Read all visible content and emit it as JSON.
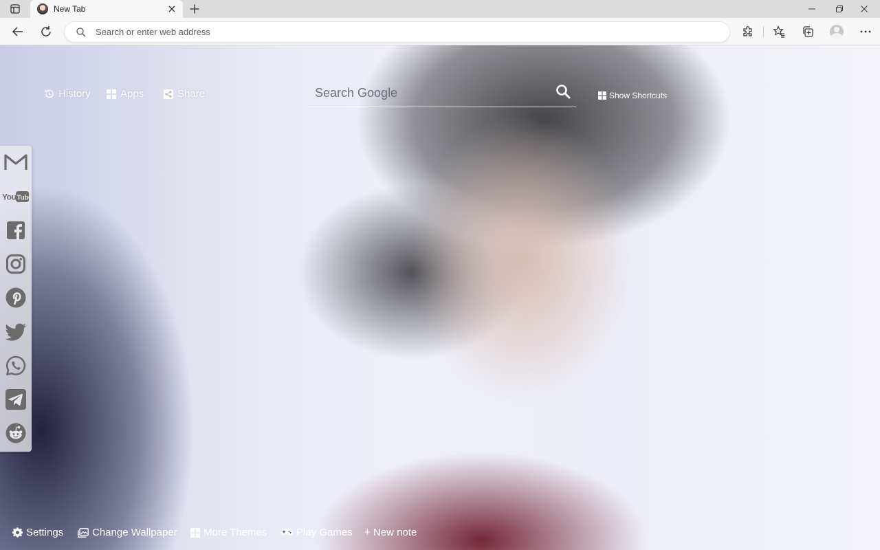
{
  "browser": {
    "tab_title": "New Tab",
    "new_tab_label": "+",
    "address_placeholder": "Search or enter web address",
    "address_value": ""
  },
  "page": {
    "top_links": [
      {
        "label": "History",
        "icon": "history-icon"
      },
      {
        "label": "Apps",
        "icon": "apps-grid-icon"
      },
      {
        "label": "Share",
        "icon": "share-icon"
      }
    ],
    "search": {
      "placeholder": "Search Google",
      "icon": "search-icon"
    },
    "show_shortcuts": "Show Shortcuts",
    "social_links": [
      {
        "name": "Gmail",
        "icon": "gmail-icon"
      },
      {
        "name": "YouTube",
        "icon": "youtube-icon",
        "text": "YouTube"
      },
      {
        "name": "Facebook",
        "icon": "facebook-icon"
      },
      {
        "name": "Instagram",
        "icon": "instagram-icon"
      },
      {
        "name": "Pinterest",
        "icon": "pinterest-icon"
      },
      {
        "name": "Twitter",
        "icon": "twitter-icon"
      },
      {
        "name": "WhatsApp",
        "icon": "whatsapp-icon"
      },
      {
        "name": "Telegram",
        "icon": "telegram-icon"
      },
      {
        "name": "Reddit",
        "icon": "reddit-icon"
      }
    ],
    "bottom_links": [
      {
        "label": "Settings",
        "icon": "gear-icon"
      },
      {
        "label": "Change Wallpaper",
        "icon": "wallpaper-icon"
      },
      {
        "label": "More Themes",
        "icon": "grid-icon"
      },
      {
        "label": "Play Games",
        "icon": "gamepad-icon"
      },
      {
        "label": "+ New note",
        "icon": ""
      }
    ]
  },
  "colors": {
    "social_icon": "#6b6b6b",
    "bottom_text": "#ffffff",
    "wallpaper_shirt": "#6e1c30"
  }
}
